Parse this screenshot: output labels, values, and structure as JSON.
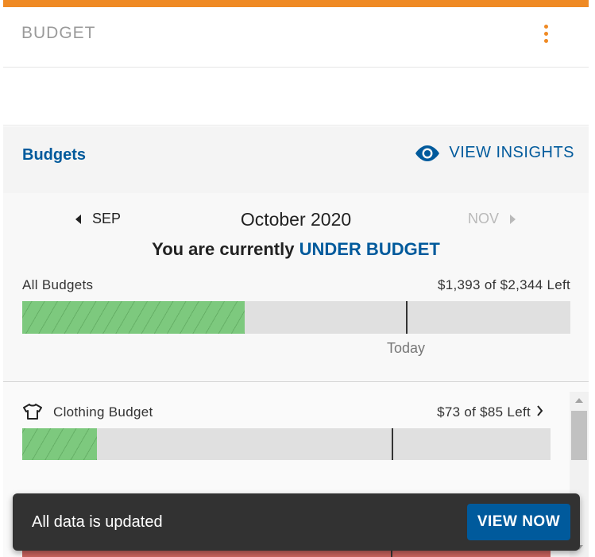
{
  "header": {
    "title": "BUDGET",
    "menu_icon": "kebab-menu-icon",
    "accent_color": "#ef8a24"
  },
  "budgets_bar": {
    "title": "Budgets",
    "insights_label": "VIEW INSIGHTS",
    "insights_icon": "eye-icon"
  },
  "month_nav": {
    "prev_label": "SEP",
    "current_label": "October 2020",
    "next_label": "NOV"
  },
  "status": {
    "prefix": "You are currently ",
    "highlight": "UNDER BUDGET"
  },
  "all_budgets": {
    "label": "All Budgets",
    "amount_text": "$1,393 of $2,344 Left",
    "spent_fraction": 0.406,
    "today_label": "Today",
    "today_fraction": 0.7
  },
  "categories": [
    {
      "label": "Clothing Budget",
      "icon": "shirt-icon",
      "amount_text": "$73 of $85 Left",
      "spent_fraction": 0.141,
      "today_fraction": 0.7
    }
  ],
  "snackbar": {
    "message": "All data is updated",
    "action_label": "VIEW NOW"
  },
  "colors": {
    "brand_blue": "#005a9c",
    "under_budget_green": "#7dc97e",
    "over_budget_red": "#c9625f",
    "snackbar_bg": "#323232"
  }
}
